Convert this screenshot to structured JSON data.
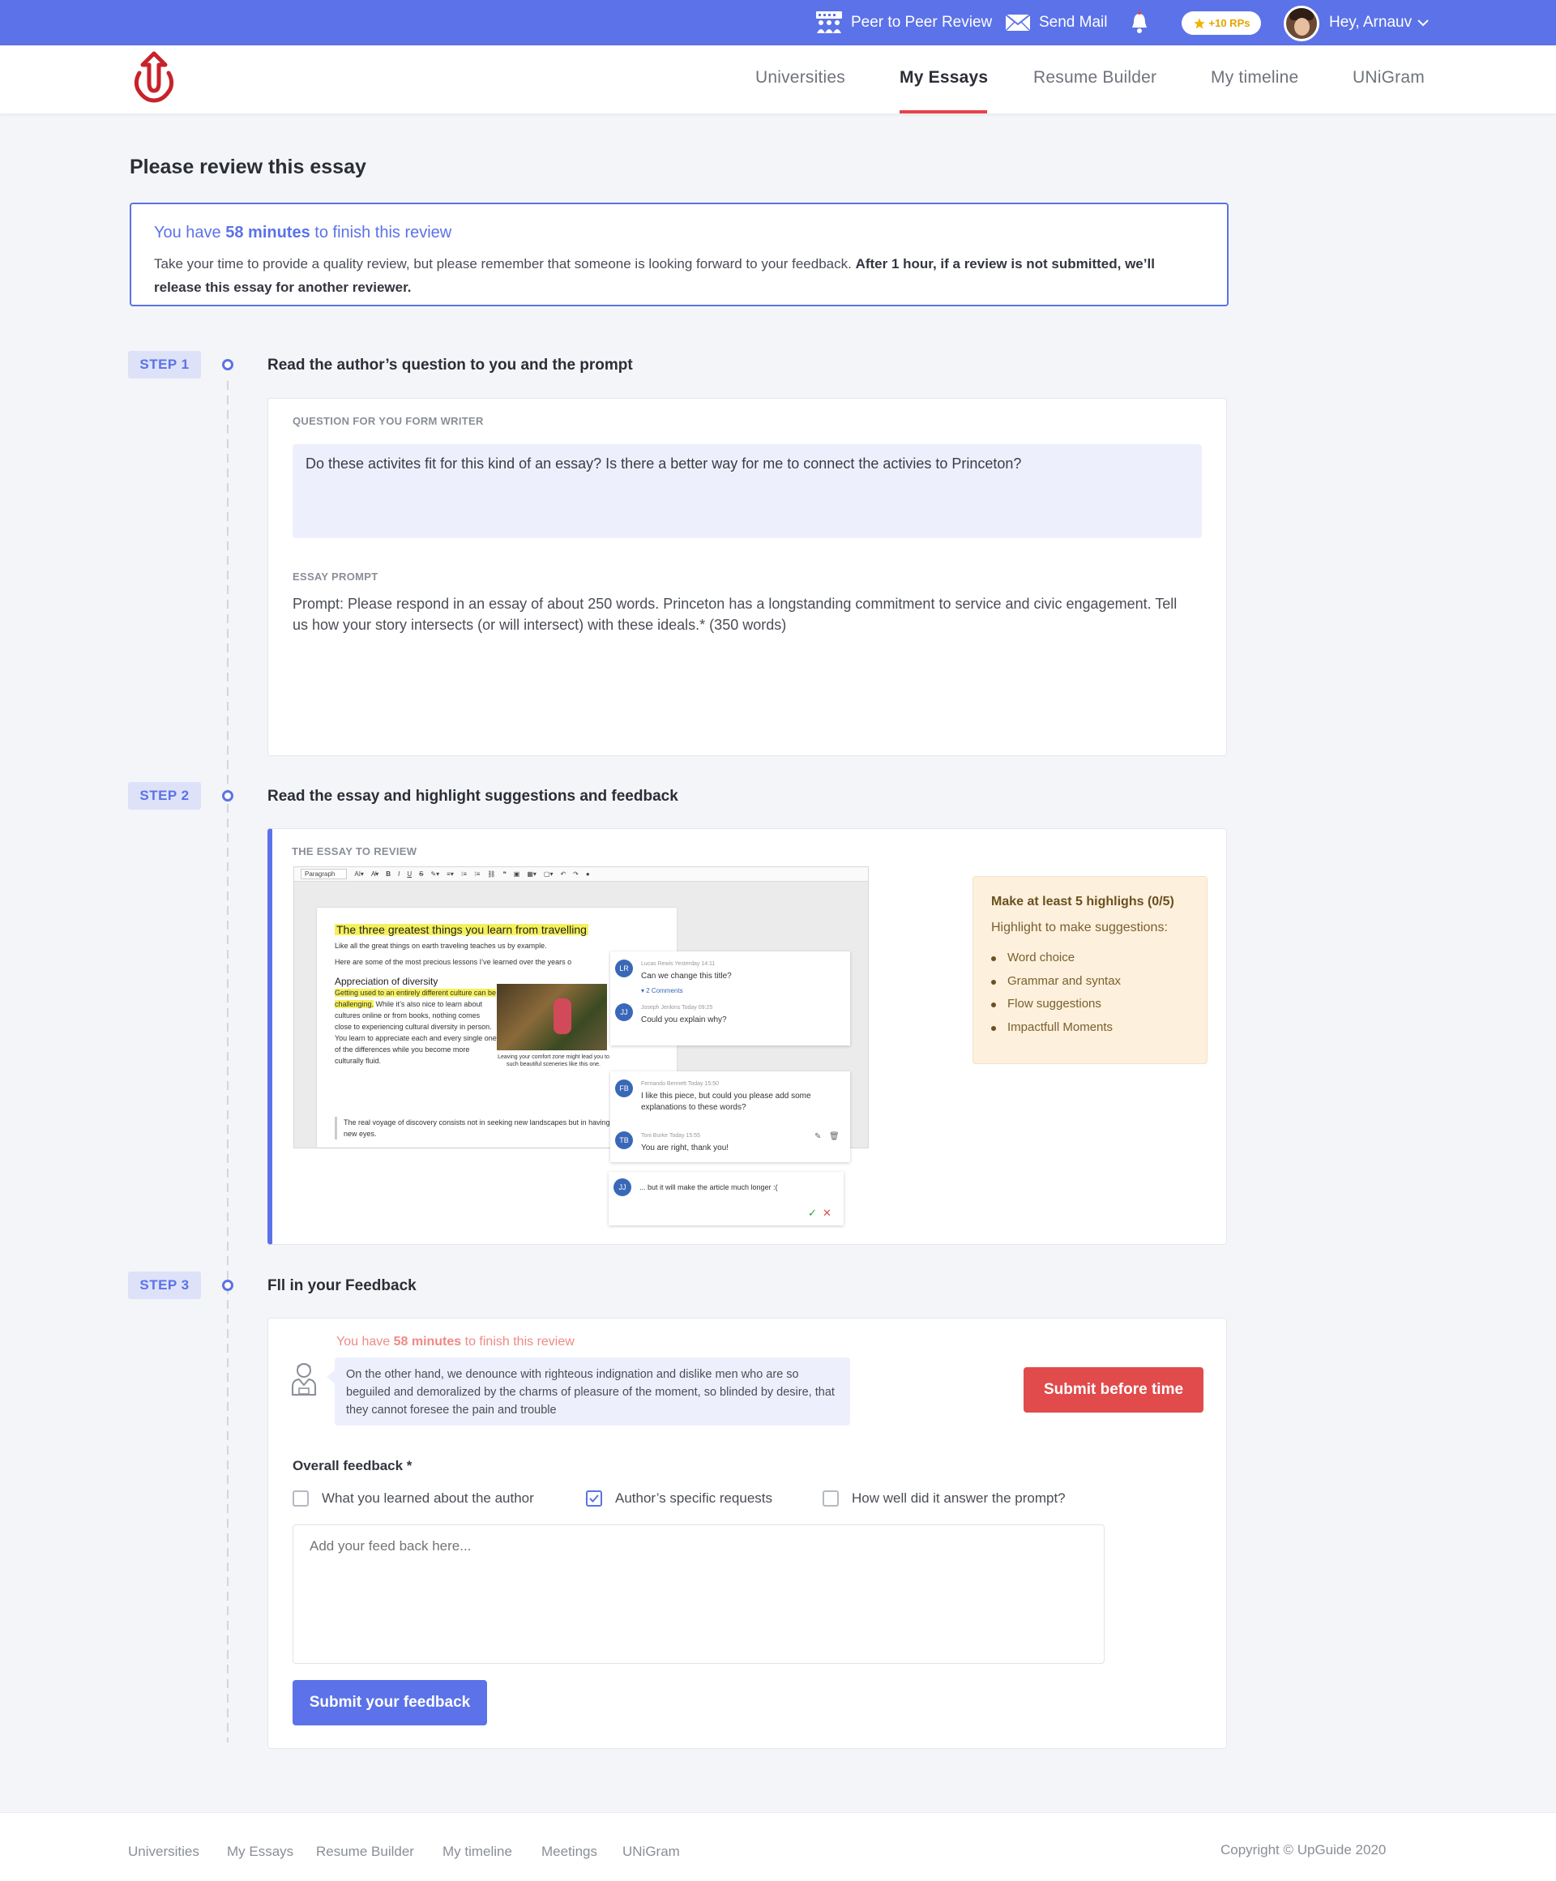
{
  "topbar": {
    "peer_review": "Peer to Peer Review",
    "send_mail": "Send Mail",
    "rp_badge": "+10 RPs",
    "greeting": "Hey, Arnauv"
  },
  "nav": {
    "links": [
      "Universities",
      "My Essays",
      "Resume Builder",
      "My timeline",
      "UNiGram"
    ],
    "active": "My Essays"
  },
  "page": {
    "title": "Please review this essay"
  },
  "notice": {
    "prefix": "You have ",
    "minutes": "58 minutes",
    "suffix": " to finish this review",
    "body": "Take your time to provide a quality review, but please remember that someone is looking forward to your feedback. ",
    "body_bold": "After 1 hour, if a review is not submitted, we’ll release this essay for another reviewer."
  },
  "step1": {
    "badge": "STEP 1",
    "title": "Read the author’s question to you and the prompt",
    "question_label": "QUESTION FOR YOU FORM WRITER",
    "question": "Do these activites fit for this kind of an essay? Is there a better way for me to connect the activies to Princeton?",
    "prompt_label": "ESSAY PROMPT",
    "prompt": "Prompt: Please respond in an essay of about 250 words. Princeton has a longstanding commitment to service and civic engagement. Tell us how your story intersects (or will intersect) with these ideals.* (350 words)"
  },
  "step2": {
    "badge": "STEP 2",
    "title": "Read the essay and highlight suggestions and feedback",
    "essay_label": "THE ESSAY TO REVIEW",
    "editor": {
      "paragraph_select": "Paragraph",
      "heading": "The three greatest things you learn from travelling",
      "intro": "Like all the great things on earth traveling teaches us by example.",
      "intro2": "Here are some of the most precious lessons I’ve learned over the years o",
      "subheading": "Appreciation of diversity",
      "highlighted": "Getting used to an entirely different culture can be challenging.",
      "body": " While it’s also nice to learn about cultures online or from books, nothing comes close to experiencing cultural diversity in person. You learn to appreciate each and every single one of the differences while you become more culturally fluid.",
      "caption": "Leaving your comfort zone might lead you to such beautiful sceneries like this one.",
      "quote": "The real voyage of discovery consists not in seeking new landscapes but in having new eyes."
    },
    "comments": [
      {
        "initials": "LR",
        "meta": "Lucas Rewis  Yesterday 14:11",
        "text": "Can we change this title?",
        "link": "▾ 2 Comments"
      },
      {
        "initials": "JJ",
        "meta": "Joseph Jenkins  Today 09:25",
        "text": "Could you explain why?"
      },
      {
        "initials": "FB",
        "meta": "Fernando Bennett  Today 15:50",
        "text": "I like this piece, but could you please add some explanations to these words?"
      },
      {
        "initials": "TB",
        "meta": "Toni Burke  Today 15:55",
        "text": "You are right, thank you!"
      },
      {
        "initials": "JJ",
        "text": "... but it will make the article much longer :("
      }
    ],
    "tips": {
      "title": "Make at least 5 highlighs (0/5)",
      "subtitle": "Highlight to make suggestions:",
      "items": [
        "Word choice",
        "Grammar  and syntax",
        "Flow suggestions",
        "Impactfull Moments"
      ]
    }
  },
  "step3": {
    "badge": "STEP 3",
    "title": "Fll in your Feedback",
    "timer_prefix": "You have ",
    "timer_minutes": "58 minutes",
    "timer_suffix": " to finish this review",
    "message": "On the other hand, we denounce with righteous indignation and dislike men who are so beguiled and demoralized by the charms of pleasure of the moment, so blinded by desire, that they cannot foresee the pain and trouble",
    "submit_before": "Submit before time",
    "feedback_label": "Overall feedback *",
    "options": [
      {
        "label": "What you learned about the author",
        "checked": false
      },
      {
        "label": "Author’s specific requests",
        "checked": true
      },
      {
        "label": "How well did it answer the prompt?",
        "checked": false
      }
    ],
    "feedback_placeholder": "Add your feed back here...",
    "submit_feedback": "Submit your feedback"
  },
  "footer": {
    "links": [
      "Universities",
      "My Essays",
      "Resume Builder",
      "My timeline",
      "Meetings",
      "UNiGram"
    ],
    "copyright": "Copyright © UpGuide 2020"
  },
  "colors": {
    "primary": "#5b72e8",
    "danger": "#e14b4b",
    "accent_underline": "#e8424a",
    "logo": "#c8222a"
  },
  "icons": [
    "peer-review-icon",
    "mail-icon",
    "bell-icon",
    "star-icon",
    "chevron-down-icon",
    "upguide-logo",
    "reviewer-avatar-icon",
    "check-icon"
  ]
}
